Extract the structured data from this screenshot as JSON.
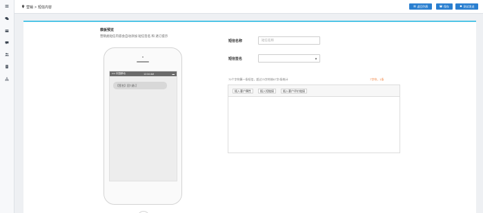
{
  "rail": {
    "icons": [
      "menu-icon",
      "chat-icon",
      "card-icon",
      "comments-icon",
      "users-icon",
      "document-icon",
      "sitemap-icon"
    ]
  },
  "breadcrumb": {
    "parent": "营销",
    "separator": ">",
    "current": "短信内容"
  },
  "toolbar": {
    "back_label": "返回列表",
    "save_label": "保存",
    "test_send_label": "测试发送"
  },
  "intro": {
    "title": "模板预览",
    "description": "营销类短信内容会自动添加 短信签名 和 退订提示"
  },
  "phone": {
    "carrier": "•••• 中国移动",
    "time": "12:34 AM",
    "battery": "▬",
    "message": "【签名】回T退订"
  },
  "form": {
    "name_label": "短信名称",
    "name_placeholder": "短信名称",
    "sign_label": "短信签名",
    "sign_value": "",
    "count_hint": "70个字符算一条短信，超过70字符按67字/条统计",
    "count_stat": "7字符，1条",
    "insert_buttons": [
      "插入客户属性",
      "插入短链接",
      "插入客户评价链接"
    ]
  },
  "colors": {
    "accent": "#2a7fd0",
    "card_top_border": "#4ec4e6",
    "warning_text": "#f07a32"
  }
}
